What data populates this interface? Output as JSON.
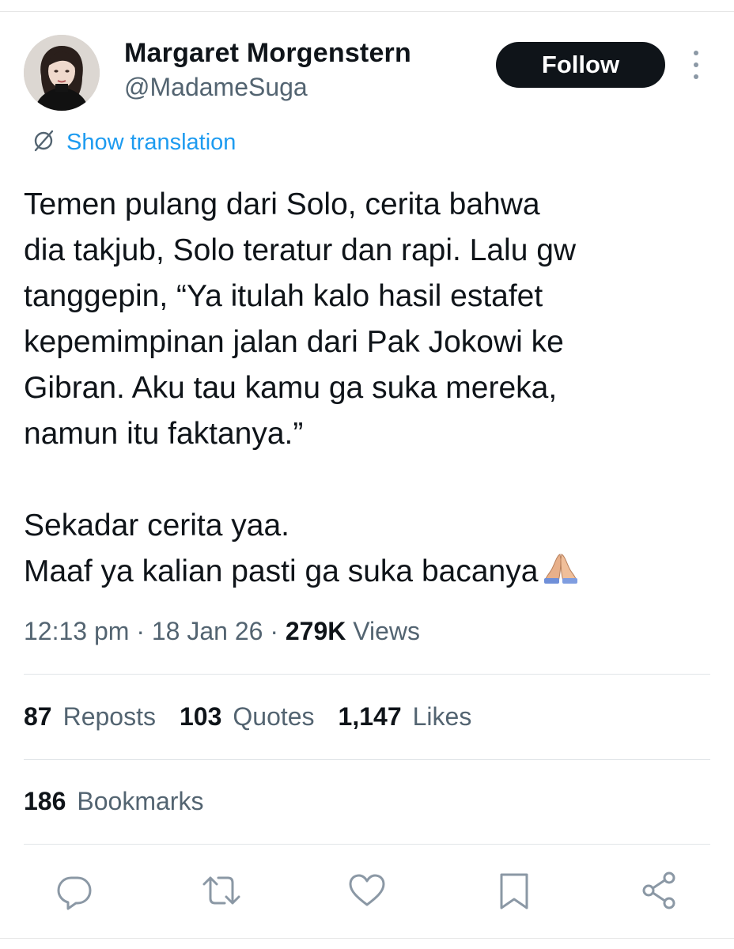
{
  "author": {
    "display_name": "Margaret Morgenstern",
    "handle": "@MadameSuga",
    "follow_label": "Follow"
  },
  "translation": {
    "label": "Show translation"
  },
  "tweet": {
    "lines": [
      "Temen pulang dari Solo, cerita bahwa",
      "dia takjub,  Solo teratur dan rapi. Lalu gw",
      "tanggepin, “Ya itulah kalo hasil estafet",
      "kepemimpinan jalan dari Pak Jokowi ke",
      "Gibran. Aku tau kamu ga suka mereka,",
      "namun itu faktanya.”",
      "Sekadar cerita yaa.",
      "Maaf ya kalian pasti ga suka bacanya"
    ],
    "emoji": "folded-hands-emoji"
  },
  "meta": {
    "time": "12:13 pm",
    "date": "18 Jan 26",
    "separator": "·",
    "views_count": "279K",
    "views_label": "Views"
  },
  "stats": {
    "reposts_count": "87",
    "reposts_label": "Reposts",
    "quotes_count": "103",
    "quotes_label": "Quotes",
    "likes_count": "1,147",
    "likes_label": "Likes",
    "bookmarks_count": "186",
    "bookmarks_label": "Bookmarks"
  },
  "actions": {
    "icons": [
      "reply-icon",
      "repost-icon",
      "like-icon",
      "bookmark-icon",
      "share-icon"
    ]
  },
  "colors": {
    "accent": "#1d9bf0",
    "text": "#0f1419",
    "secondary": "#536471",
    "icon": "#8b98a5",
    "button_bg": "#0f1419"
  }
}
